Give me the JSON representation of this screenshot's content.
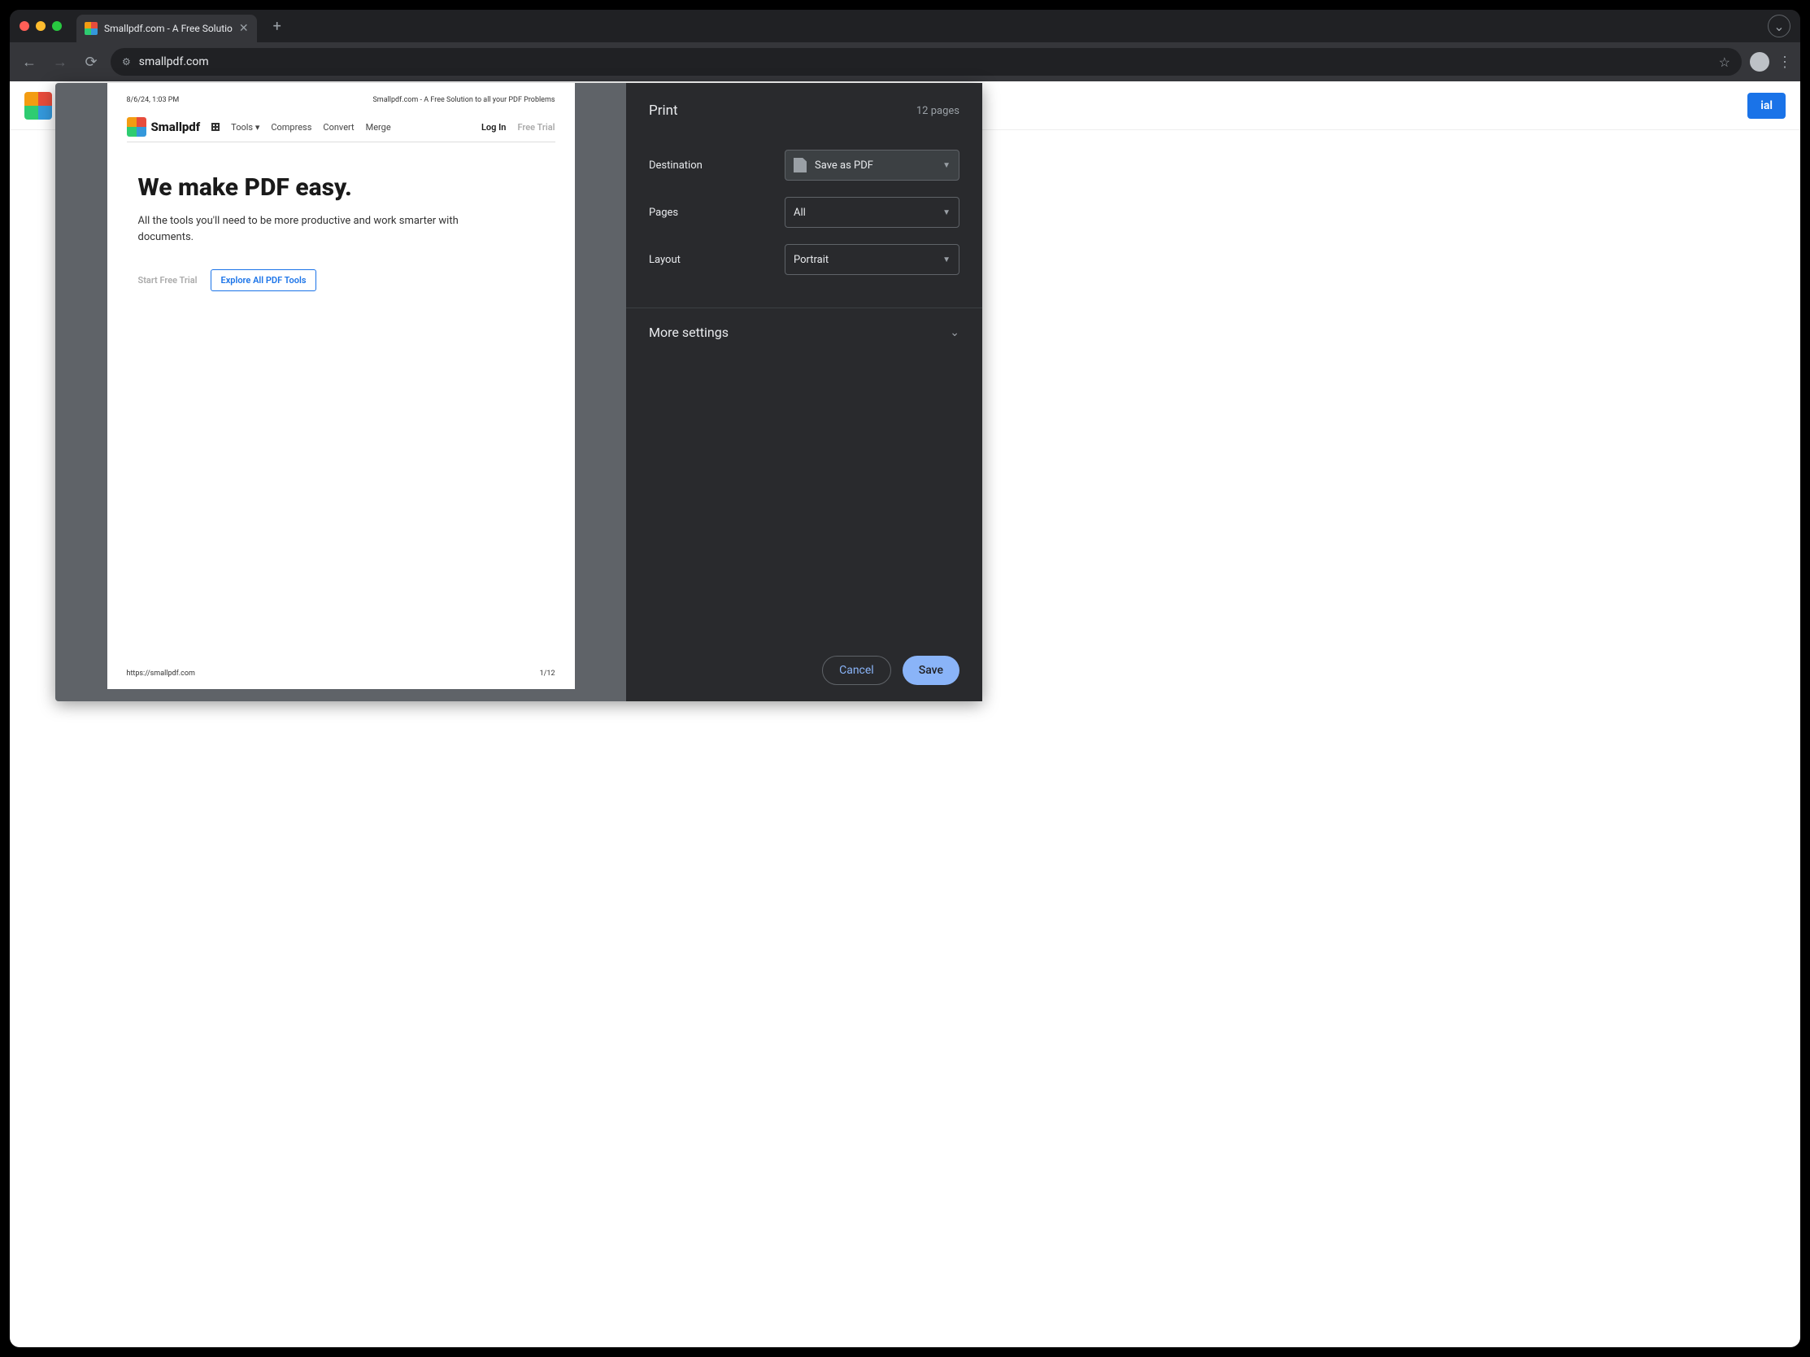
{
  "browser": {
    "tab_title": "Smallpdf.com - A Free Solutio",
    "url": "smallpdf.com"
  },
  "background_page": {
    "cta_partial": "ial"
  },
  "print": {
    "title": "Print",
    "page_count": "12 pages",
    "rows": {
      "destination": {
        "label": "Destination",
        "value": "Save as PDF"
      },
      "pages": {
        "label": "Pages",
        "value": "All"
      },
      "layout": {
        "label": "Layout",
        "value": "Portrait"
      }
    },
    "more_settings": "More settings",
    "cancel": "Cancel",
    "save": "Save"
  },
  "preview": {
    "timestamp": "8/6/24, 1:03 PM",
    "header_title": "Smallpdf.com - A Free Solution to all your PDF Problems",
    "brand": "Smallpdf",
    "nav": {
      "tools": "Tools",
      "compress": "Compress",
      "convert": "Convert",
      "merge": "Merge",
      "login": "Log In",
      "free_trial": "Free Trial"
    },
    "hero_h1": "We make PDF easy.",
    "hero_sub": "All the tools you'll need to be more productive and work smarter with documents.",
    "cta1": "Start Free Trial",
    "cta2": "Explore All PDF Tools",
    "footer_url": "https://smallpdf.com",
    "footer_page": "1/12"
  }
}
